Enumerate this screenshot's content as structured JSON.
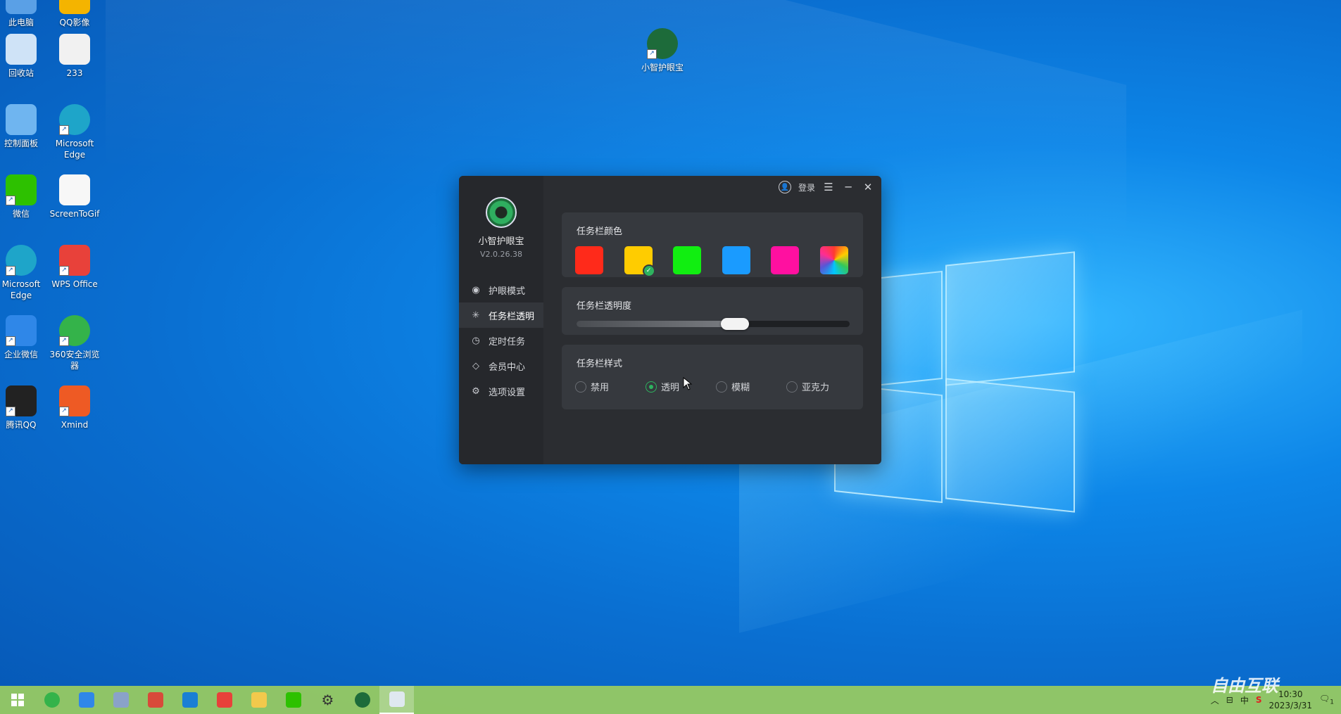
{
  "desktop": {
    "icons": [
      {
        "label": "此电脑",
        "icon": "this-pc-icon"
      },
      {
        "label": "QQ影像",
        "icon": "qq-image-icon"
      },
      {
        "label": "回收站",
        "icon": "recycle-bin-icon"
      },
      {
        "label": "233",
        "icon": "text-file-icon"
      },
      {
        "label": "控制面板",
        "icon": "control-panel-icon"
      },
      {
        "label": "Microsoft Edge",
        "icon": "edge-icon"
      },
      {
        "label": "微信",
        "icon": "wechat-icon"
      },
      {
        "label": "ScreenToGif",
        "icon": "screentogif-icon"
      },
      {
        "label": "Microsoft Edge",
        "icon": "edge-icon"
      },
      {
        "label": "WPS Office",
        "icon": "wps-icon"
      },
      {
        "label": "企业微信",
        "icon": "wecom-icon"
      },
      {
        "label": "360安全浏览器",
        "icon": "360-browser-icon"
      },
      {
        "label": "腾讯QQ",
        "icon": "qq-icon"
      },
      {
        "label": "Xmind",
        "icon": "xmind-icon"
      },
      {
        "label": "小智护眼宝",
        "icon": "eyecare-icon"
      }
    ]
  },
  "app": {
    "name": "小智护眼宝",
    "version": "V2.0.26.38",
    "login_label": "登录",
    "menu": [
      {
        "label": "护眼模式",
        "icon": "eye-icon",
        "glyph": "◉"
      },
      {
        "label": "任务栏透明",
        "icon": "sparkle-icon",
        "glyph": "✳"
      },
      {
        "label": "定时任务",
        "icon": "clock-icon",
        "glyph": "◷"
      },
      {
        "label": "会员中心",
        "icon": "diamond-icon",
        "glyph": "◇"
      },
      {
        "label": "选项设置",
        "icon": "gear-icon",
        "glyph": "⚙"
      }
    ],
    "active_menu": 1,
    "color_card": {
      "title": "任务栏颜色",
      "swatches": [
        "#ff2a1a",
        "#ffcc00",
        "#11ee11",
        "#1a9bff",
        "#ff10a0",
        "rainbow"
      ],
      "selected": 1
    },
    "opacity_card": {
      "title": "任务栏透明度",
      "value": 0.58
    },
    "style_card": {
      "title": "任务栏样式",
      "options": [
        "禁用",
        "透明",
        "模糊",
        "亚克力"
      ],
      "selected": 1
    }
  },
  "taskbar": {
    "apps": [
      "start-icon",
      "360-icon",
      "wecom-icon",
      "notes-icon",
      "image-viewer-icon",
      "store-icon",
      "wps-icon",
      "folder-icon",
      "wechat-icon",
      "settings-icon",
      "eyecare-icon",
      "remote-desktop-icon"
    ],
    "active_index": 11,
    "tray_ime": "中",
    "time": "10:30",
    "date": "2023/3/31",
    "notification_count": "1"
  },
  "watermark": "自由互联"
}
